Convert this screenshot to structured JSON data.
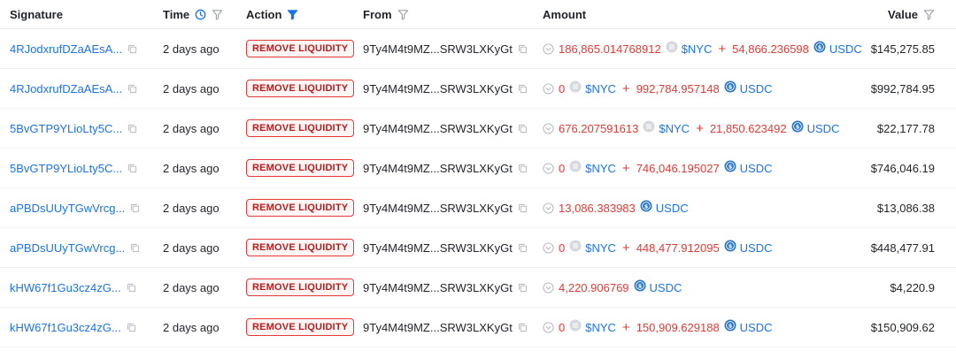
{
  "header": {
    "signature": "Signature",
    "time": "Time",
    "action": "Action",
    "from": "From",
    "amount": "Amount",
    "value": "Value"
  },
  "rows": [
    {
      "signature": "4RJodxrufDZaAEsA...",
      "time": "2 days ago",
      "action": "REMOVE LIQUIDITY",
      "from": "9Ty4M4t9MZ...SRW3LXKyGt",
      "amounts": [
        {
          "value": "186,865.014768912",
          "token": "$NYC",
          "icon": "nyc-token-icon"
        },
        {
          "value": "54,866.236598",
          "token": "USDC",
          "icon": "usdc-token-icon"
        }
      ],
      "usd_value": "$145,275.85"
    },
    {
      "signature": "4RJodxrufDZaAEsA...",
      "time": "2 days ago",
      "action": "REMOVE LIQUIDITY",
      "from": "9Ty4M4t9MZ...SRW3LXKyGt",
      "amounts": [
        {
          "value": "0",
          "token": "$NYC",
          "icon": "nyc-token-icon"
        },
        {
          "value": "992,784.957148",
          "token": "USDC",
          "icon": "usdc-token-icon"
        }
      ],
      "usd_value": "$992,784.95"
    },
    {
      "signature": "5BvGTP9YLioLty5C...",
      "time": "2 days ago",
      "action": "REMOVE LIQUIDITY",
      "from": "9Ty4M4t9MZ...SRW3LXKyGt",
      "amounts": [
        {
          "value": "676.207591613",
          "token": "$NYC",
          "icon": "nyc-token-icon"
        },
        {
          "value": "21,850.623492",
          "token": "USDC",
          "icon": "usdc-token-icon"
        }
      ],
      "usd_value": "$22,177.78"
    },
    {
      "signature": "5BvGTP9YLioLty5C...",
      "time": "2 days ago",
      "action": "REMOVE LIQUIDITY",
      "from": "9Ty4M4t9MZ...SRW3LXKyGt",
      "amounts": [
        {
          "value": "0",
          "token": "$NYC",
          "icon": "nyc-token-icon"
        },
        {
          "value": "746,046.195027",
          "token": "USDC",
          "icon": "usdc-token-icon"
        }
      ],
      "usd_value": "$746,046.19"
    },
    {
      "signature": "aPBDsUUyTGwVrcg...",
      "time": "2 days ago",
      "action": "REMOVE LIQUIDITY",
      "from": "9Ty4M4t9MZ...SRW3LXKyGt",
      "amounts": [
        {
          "value": "13,086.383983",
          "token": "USDC",
          "icon": "usdc-token-icon"
        }
      ],
      "usd_value": "$13,086.38"
    },
    {
      "signature": "aPBDsUUyTGwVrcg...",
      "time": "2 days ago",
      "action": "REMOVE LIQUIDITY",
      "from": "9Ty4M4t9MZ...SRW3LXKyGt",
      "amounts": [
        {
          "value": "0",
          "token": "$NYC",
          "icon": "nyc-token-icon"
        },
        {
          "value": "448,477.912095",
          "token": "USDC",
          "icon": "usdc-token-icon"
        }
      ],
      "usd_value": "$448,477.91"
    },
    {
      "signature": "kHW67f1Gu3cz4zG...",
      "time": "2 days ago",
      "action": "REMOVE LIQUIDITY",
      "from": "9Ty4M4t9MZ...SRW3LXKyGt",
      "amounts": [
        {
          "value": "4,220.906769",
          "token": "USDC",
          "icon": "usdc-token-icon"
        }
      ],
      "usd_value": "$4,220.9"
    },
    {
      "signature": "kHW67f1Gu3cz4zG...",
      "time": "2 days ago",
      "action": "REMOVE LIQUIDITY",
      "from": "9Ty4M4t9MZ...SRW3LXKyGt",
      "amounts": [
        {
          "value": "0",
          "token": "$NYC",
          "icon": "nyc-token-icon"
        },
        {
          "value": "150,909.629188",
          "token": "USDC",
          "icon": "usdc-token-icon"
        }
      ],
      "usd_value": "$150,909.62"
    }
  ],
  "colors": {
    "link": "#1a73e8",
    "negative": "#e53935",
    "badge_border": "#e53935",
    "filter_active": "#1a73e8",
    "icon_gray": "#9aa0a6"
  }
}
